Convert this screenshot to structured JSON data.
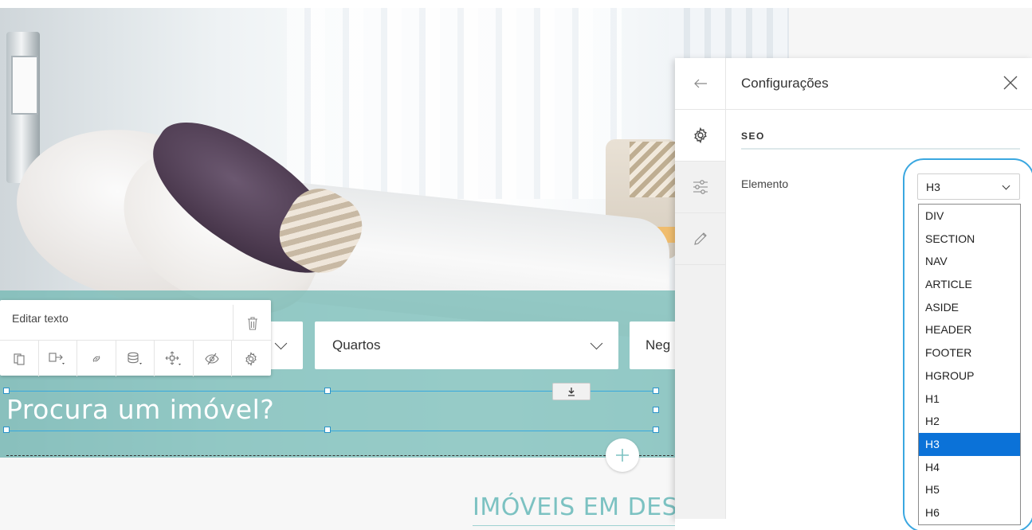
{
  "hero": {
    "search_fields": [
      {
        "label": ""
      },
      {
        "label": "Quartos"
      },
      {
        "label": "Neg"
      }
    ],
    "heading": "Procura um imóvel?",
    "featured": "IMÓVEIS EM DESTAQUE"
  },
  "toolbar": {
    "title": "Editar texto",
    "icons": [
      "copy-icon",
      "move-to-icon",
      "link-icon",
      "layers-icon",
      "arrows-move-icon",
      "visibility-off-icon",
      "settings-icon"
    ]
  },
  "panel": {
    "title": "Configurações",
    "section": "SEO",
    "element_label": "Elemento",
    "element_value": "H3",
    "options": [
      "DIV",
      "SECTION",
      "NAV",
      "ARTICLE",
      "ASIDE",
      "HEADER",
      "FOOTER",
      "HGROUP",
      "H1",
      "H2",
      "H3",
      "H4",
      "H5",
      "H6"
    ],
    "selected_option": "H3",
    "rail_icons": [
      "back-arrow-icon",
      "gear-icon",
      "sliders-icon",
      "pencil-icon"
    ]
  },
  "colors": {
    "accent": "#3aa7e0",
    "teal": "#6db7b2",
    "selected_option": "#0b72d8"
  }
}
